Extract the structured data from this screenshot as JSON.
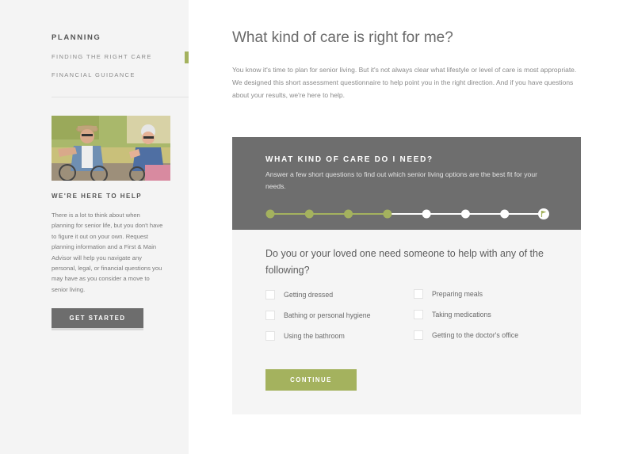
{
  "colors": {
    "accent": "#a4b25e",
    "panel_dark": "#6e6e6e",
    "button_dark": "#6d6d6d"
  },
  "sidebar": {
    "heading": "PLANNING",
    "items": [
      {
        "label": "FINDING THE RIGHT CARE",
        "active": true
      },
      {
        "label": "FINANCIAL GUIDANCE",
        "active": false
      }
    ],
    "help_heading": "WE'RE HERE TO HELP",
    "help_text": "There is a lot to think about when planning for senior life, but you don't have to figure it out on your own. Request planning information and a First & Main Advisor will help you navigate any personal, legal, or financial questions you may have as you consider a move to senior living.",
    "cta_label": "GET STARTED"
  },
  "main": {
    "title": "What kind of care is right for me?",
    "intro": "You know it's time to plan for senior living. But it's not always clear what lifestyle or level of care is most appropriate. We designed this short assessment questionnaire to help point you in the right direction. And if you have questions about your results, we're here to help."
  },
  "questionnaire": {
    "title": "WHAT KIND OF CARE DO I NEED?",
    "subtitle": "Answer a few short questions to find out which senior living options are the best fit for your needs.",
    "steps_total": 8,
    "steps_completed": 4,
    "question": "Do you or your loved one need someone to help with any of the following?",
    "options": [
      {
        "label": "Getting dressed",
        "checked": false
      },
      {
        "label": "Bathing or personal hygiene",
        "checked": false
      },
      {
        "label": "Using the bathroom",
        "checked": false
      },
      {
        "label": "Preparing meals",
        "checked": false
      },
      {
        "label": "Taking medications",
        "checked": false
      },
      {
        "label": "Getting to the doctor's office",
        "checked": false
      }
    ],
    "continue_label": "CONTINUE"
  }
}
